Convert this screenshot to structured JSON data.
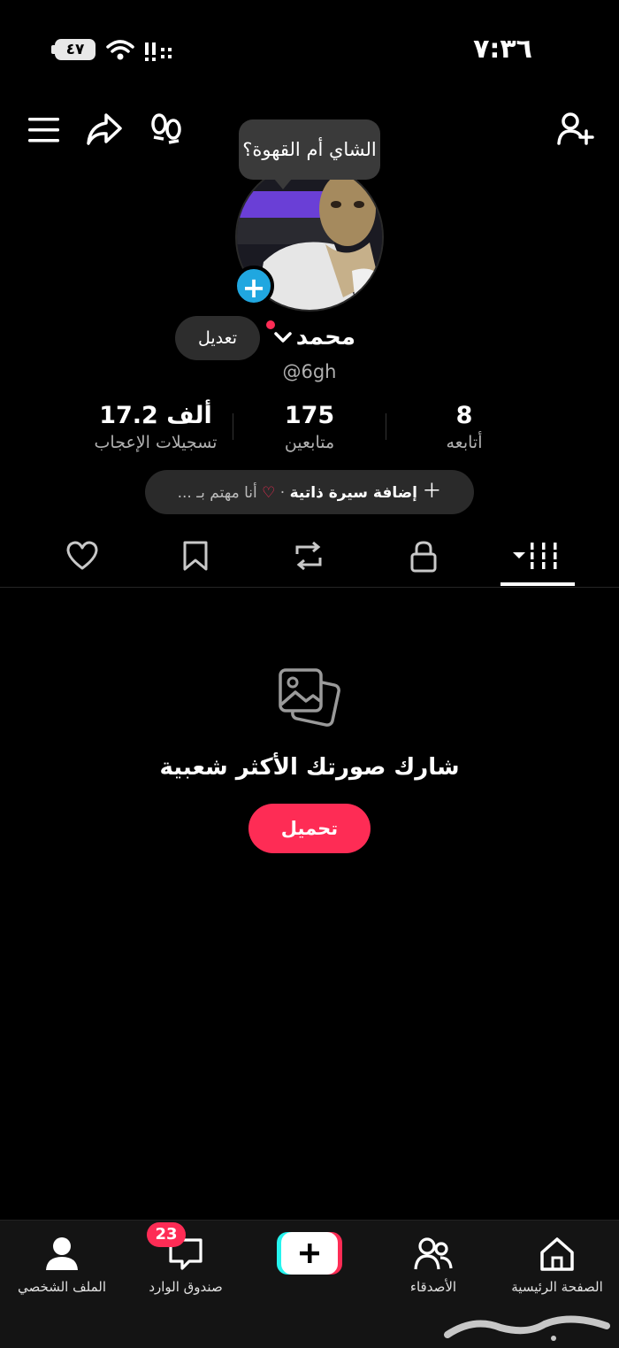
{
  "status_bar": {
    "time": "٧:٣٦",
    "battery": "٤٧"
  },
  "profile": {
    "note_bubble": "الشاي أم القهوة؟",
    "name": "محمد",
    "handle": "@6gh",
    "edit_label": "تعديل"
  },
  "stats": [
    {
      "value": "8",
      "label": "أتابعه"
    },
    {
      "value": "175",
      "label": "متابعين"
    },
    {
      "value": "17.2 ألف",
      "label": "تسجيلات الإعجاب"
    }
  ],
  "bio": {
    "add_label": "إضافة سيرة ذاتية",
    "separator": "·",
    "interest_label": "أنا مهتم بـ ..."
  },
  "tabs": [
    "videos-grid",
    "private-lock",
    "reposts",
    "favorites-bookmark",
    "liked-heart"
  ],
  "empty_state": {
    "title": "شارك صورتك الأكثر شعبية",
    "button": "تحميل"
  },
  "bottom_nav": {
    "home": "الصفحة الرئيسية",
    "friends": "الأصدقاء",
    "inbox": "صندوق الوارد",
    "inbox_badge": "23",
    "profile": "الملف الشخصي"
  },
  "watermark": "حراج",
  "colors": {
    "accent": "#fe2c55",
    "badge_blue": "#20a7e0",
    "background": "#000000"
  }
}
